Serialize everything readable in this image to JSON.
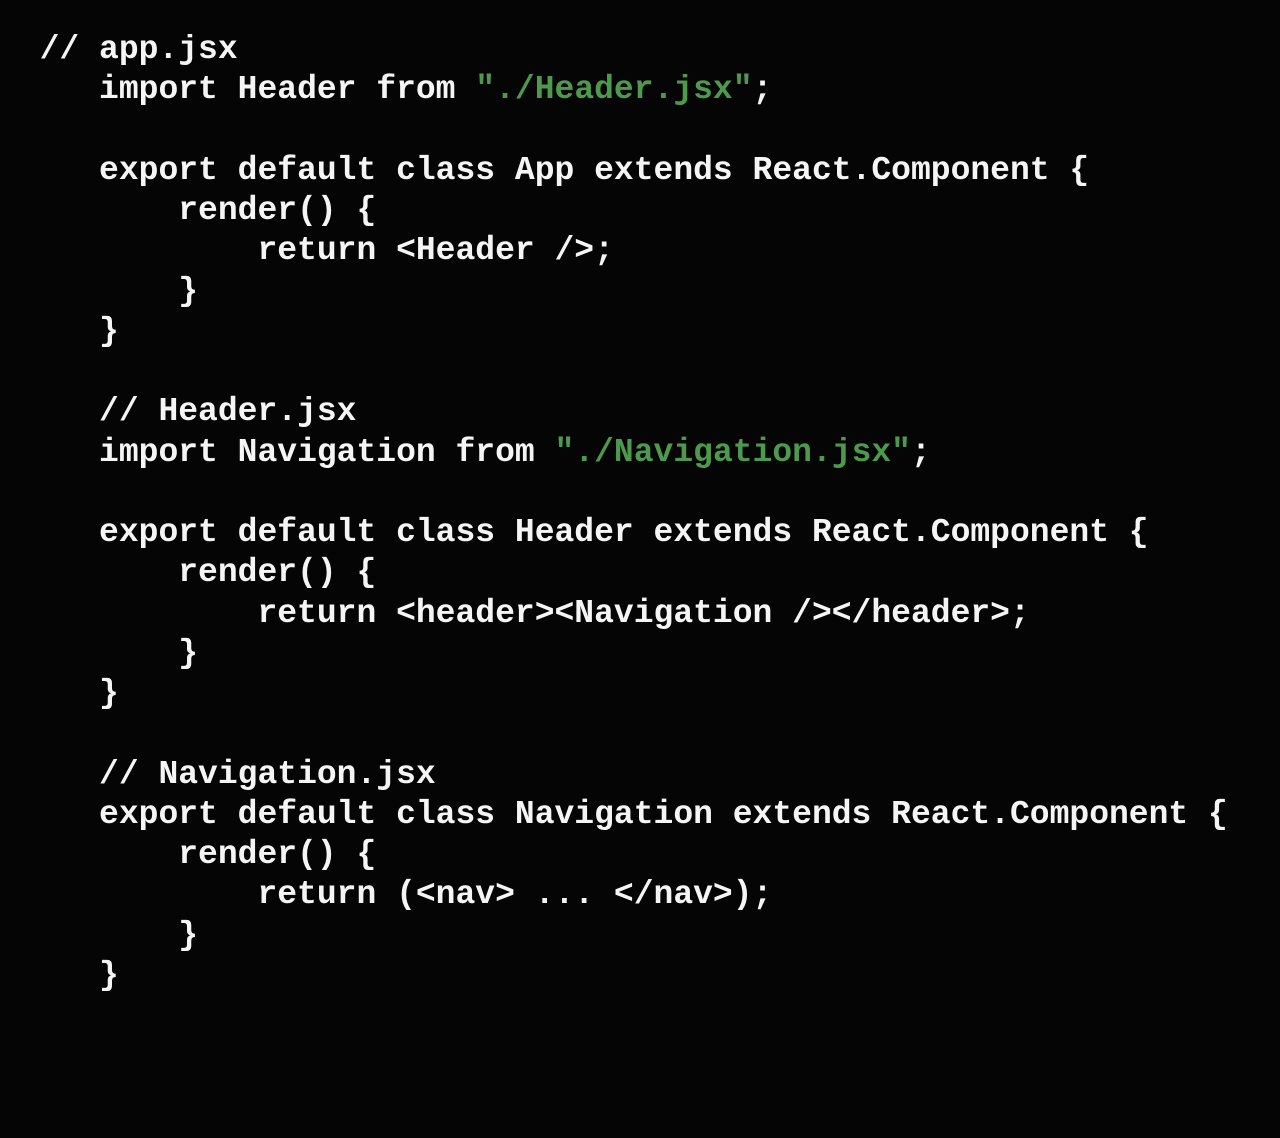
{
  "tokens": [
    {
      "cls": "c",
      "t": "  // app.jsx\n"
    },
    {
      "cls": "c",
      "t": "     import Header from "
    },
    {
      "cls": "s",
      "t": "\"./Header.jsx\""
    },
    {
      "cls": "c",
      "t": ";\n"
    },
    {
      "cls": "c",
      "t": "\n"
    },
    {
      "cls": "c",
      "t": "     export default class App extends React.Component {\n"
    },
    {
      "cls": "c",
      "t": "         render() {\n"
    },
    {
      "cls": "c",
      "t": "             return <Header />;\n"
    },
    {
      "cls": "c",
      "t": "         }\n"
    },
    {
      "cls": "c",
      "t": "     }\n"
    },
    {
      "cls": "c",
      "t": "\n"
    },
    {
      "cls": "c",
      "t": "     // Header.jsx\n"
    },
    {
      "cls": "c",
      "t": "     import Navigation from "
    },
    {
      "cls": "s",
      "t": "\"./Navigation.jsx\""
    },
    {
      "cls": "c",
      "t": ";\n"
    },
    {
      "cls": "c",
      "t": "\n"
    },
    {
      "cls": "c",
      "t": "     export default class Header extends React.Component {\n"
    },
    {
      "cls": "c",
      "t": "         render() {\n"
    },
    {
      "cls": "c",
      "t": "             return <header><Navigation /></header>;\n"
    },
    {
      "cls": "c",
      "t": "         }\n"
    },
    {
      "cls": "c",
      "t": "     }\n"
    },
    {
      "cls": "c",
      "t": "\n"
    },
    {
      "cls": "c",
      "t": "     // Navigation.jsx\n"
    },
    {
      "cls": "c",
      "t": "     export default class Navigation extends React.Component {\n"
    },
    {
      "cls": "c",
      "t": "         render() {\n"
    },
    {
      "cls": "c",
      "t": "             return (<nav> ... </nav>);\n"
    },
    {
      "cls": "c",
      "t": "         }\n"
    },
    {
      "cls": "c",
      "t": "     }\n"
    }
  ]
}
